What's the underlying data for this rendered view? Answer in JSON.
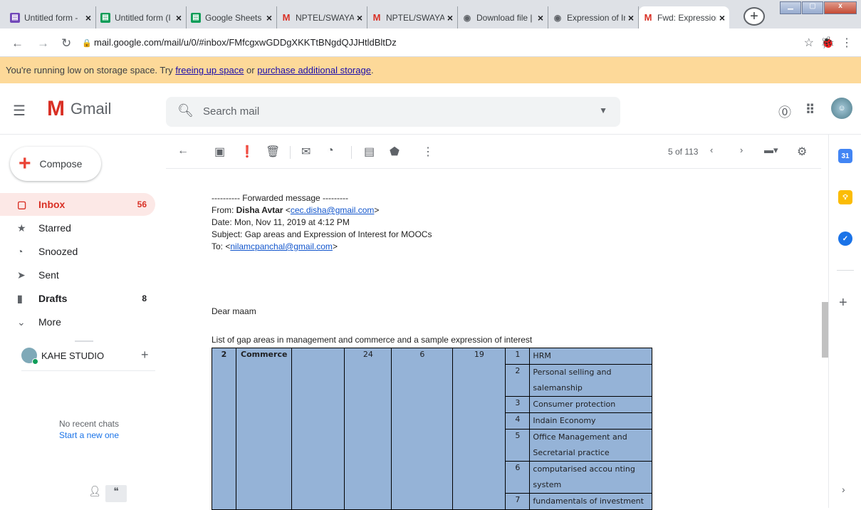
{
  "browser": {
    "tabs": [
      {
        "title": "Untitled form -",
        "icon": "forms-icon",
        "color": "#7248b9",
        "active": false
      },
      {
        "title": "Untitled form (I",
        "icon": "sheets-icon",
        "color": "#0f9d58",
        "active": false
      },
      {
        "title": "Google Sheets",
        "icon": "sheets-icon",
        "color": "#0f9d58",
        "active": false
      },
      {
        "title": "NPTEL/SWAYAM",
        "icon": "gmail-icon",
        "color": "#d93025",
        "active": false
      },
      {
        "title": "NPTEL/SWAYAM",
        "icon": "gmail-icon",
        "color": "#d93025",
        "active": false
      },
      {
        "title": "Download file |",
        "icon": "globe-icon",
        "color": "#5f6368",
        "active": false
      },
      {
        "title": "Expression of Ir",
        "icon": "globe-icon",
        "color": "#5f6368",
        "active": false
      },
      {
        "title": "Fwd: Expression",
        "icon": "gmail-icon",
        "color": "#d93025",
        "active": true
      }
    ],
    "url": "mail.google.com/mail/u/0/#inbox/FMfcgxwGDDgXKKTtBNgdQJJHtldBltDz"
  },
  "banner": {
    "text_before": "You're running low on storage space. Try ",
    "link1": "freeing up space",
    "text_mid": " or ",
    "link2": "purchase additional storage",
    "text_after": "."
  },
  "header": {
    "app_name": "Gmail",
    "search_placeholder": "Search mail"
  },
  "sidebar": {
    "compose_label": "Compose",
    "items": [
      {
        "label": "Inbox",
        "count": "56",
        "icon": "inbox-icon",
        "active": true,
        "bold": true
      },
      {
        "label": "Starred",
        "count": "",
        "icon": "star-icon",
        "active": false,
        "bold": false
      },
      {
        "label": "Snoozed",
        "count": "",
        "icon": "clock-icon",
        "active": false,
        "bold": false
      },
      {
        "label": "Sent",
        "count": "",
        "icon": "send-icon",
        "active": false,
        "bold": false
      },
      {
        "label": "Drafts",
        "count": "8",
        "icon": "draft-icon",
        "active": false,
        "bold": true
      },
      {
        "label": "More",
        "count": "",
        "icon": "chevron-down-icon",
        "active": false,
        "bold": false
      }
    ],
    "hangouts_user": "KAHE STUDIO",
    "no_recent": "No recent chats",
    "start_new": "Start a new one"
  },
  "toolbar": {
    "pager": "5 of 113"
  },
  "email": {
    "fwd_header": "---------- Forwarded message ---------",
    "from_label": "From: ",
    "from_name": "Disha Avtar",
    "from_email": "cec.disha@gmail.com",
    "date": "Date: Mon, Nov 11, 2019 at 4:12 PM",
    "subject": "Subject: Gap areas and Expression of Interest for MOOCs",
    "to_label": "To: ",
    "to_email": "nilamcpanchal@gmail.com",
    "greeting": "Dear maam",
    "list_title": "List of gap areas in management and commerce and a sample expression of interest",
    "table": {
      "sno": "2",
      "discipline": "Commerce",
      "col3": "",
      "col4": "24",
      "col5": "6",
      "col6": "19",
      "rows": [
        {
          "n": "1",
          "topic": "HRM"
        },
        {
          "n": "2",
          "topic": "Personal selling and salemanship"
        },
        {
          "n": "3",
          "topic": "Consumer protection"
        },
        {
          "n": "4",
          "topic": "Indain Economy"
        },
        {
          "n": "5",
          "topic": "Office Management and Secretarial practice"
        },
        {
          "n": "6",
          "topic": "computarised accou nting system"
        },
        {
          "n": "7",
          "topic": "fundamentals of investment"
        }
      ]
    }
  }
}
